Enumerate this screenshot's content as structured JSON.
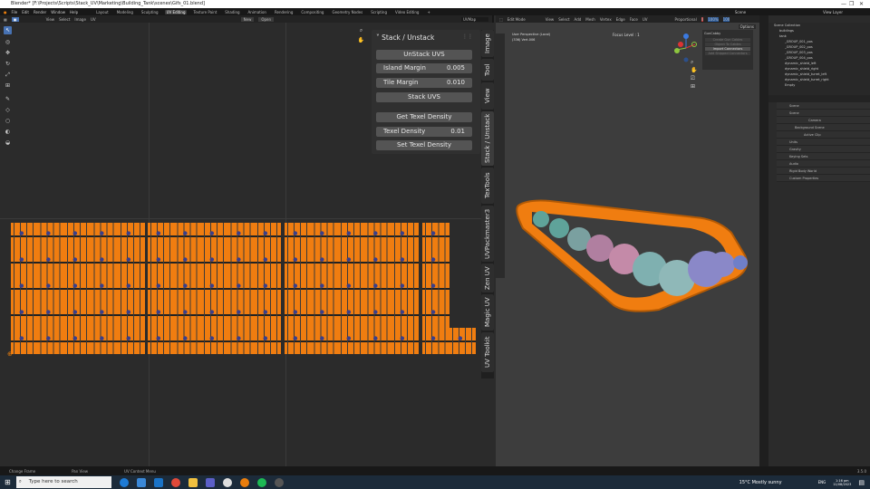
{
  "window": {
    "title": "Blender* [F:\\Projects\\Scripts\\Stack_UV\\Marketing\\Building_Tank\\scenes\\Gifs_01.blend]",
    "controls": [
      "—",
      "❐",
      "✕"
    ]
  },
  "menu": [
    "File",
    "Edit",
    "Render",
    "Window",
    "Help"
  ],
  "workspaces": [
    "Layout",
    "Modeling",
    "Sculpting",
    "UV Editing",
    "Texture Paint",
    "Shading",
    "Animation",
    "Rendering",
    "Compositing",
    "Geometry Nodes",
    "Scripting",
    "Video Editing",
    "+"
  ],
  "active_workspace": "UV Editing",
  "uv_header": {
    "menus": [
      "View",
      "Select",
      "Image",
      "UV"
    ],
    "new_label": "New",
    "open_label": "Open",
    "uvmap": "UVMap"
  },
  "stack_panel": {
    "title": "Stack / Unstack",
    "unstack": "UnStack UVS",
    "island_margin_label": "Island Margin",
    "island_margin": "0.005",
    "tile_margin_label": "Tile Margin",
    "tile_margin": "0.010",
    "stack": "Stack UVS",
    "get_td": "Get Texel Density",
    "td_label": "Texel Density",
    "td": "0.01",
    "set_td": "Set Texel Density"
  },
  "uv_tabs": [
    "Image",
    "Tool",
    "View",
    "Stack / Unstack",
    "TexTools",
    "UVPackmaster3",
    "Zen UV",
    "Magic UV",
    "UV Toolkit"
  ],
  "viewport": {
    "mode": "Edit Mode",
    "menus": [
      "View",
      "Select",
      "Add",
      "Mesh",
      "Vertex",
      "Edge",
      "Face",
      "UV"
    ],
    "pivot": "Proportional",
    "stats": [
      "0",
      "100%",
      "100"
    ],
    "options": "Options",
    "overlay1": "User Perspective (Local)",
    "overlay2": "(336) Vert.006",
    "focus": "Focus Level : 1",
    "gun_title": "GunCabby",
    "gun_buttons": [
      "Create Gun Cables",
      "Object To Cables",
      "Import Connectors",
      "Add Shipped Connectors"
    ]
  },
  "scene": {
    "scene_label": "Scene",
    "view_layer": "View Layer"
  },
  "outliner": [
    "Scene Collection",
    "buildings",
    "tank",
    "_GROUP_001_pos",
    "_GROUP_002_pos",
    "_GROUP_003_pos",
    "_GROUP_004_pos",
    "dynamic_shield_left",
    "dynamic_shield_right",
    "dynamic_shield_turret_left",
    "dynamic_shield_turret_right",
    "Empty"
  ],
  "properties": {
    "header": "Scene",
    "section": "Scene",
    "camera": "Camera",
    "bg_scene": "Background Scene",
    "active_clip": "Active Clip",
    "panels": [
      "Units",
      "Gravity",
      "Keying Sets",
      "Audio",
      "Rigid Body World",
      "Custom Properties"
    ]
  },
  "status": [
    "Change Frame",
    "Pan View",
    "UV Context Menu"
  ],
  "version": "3.5.0",
  "taskbar": {
    "search_placeholder": "Type here to search",
    "weather": "15°C  Mostly sunny",
    "lang": "ENG",
    "time": "1:16 pm",
    "date": "11/08/2023"
  },
  "colors": {
    "uv_orange": "#f07d10",
    "accent": "#4772b3"
  }
}
